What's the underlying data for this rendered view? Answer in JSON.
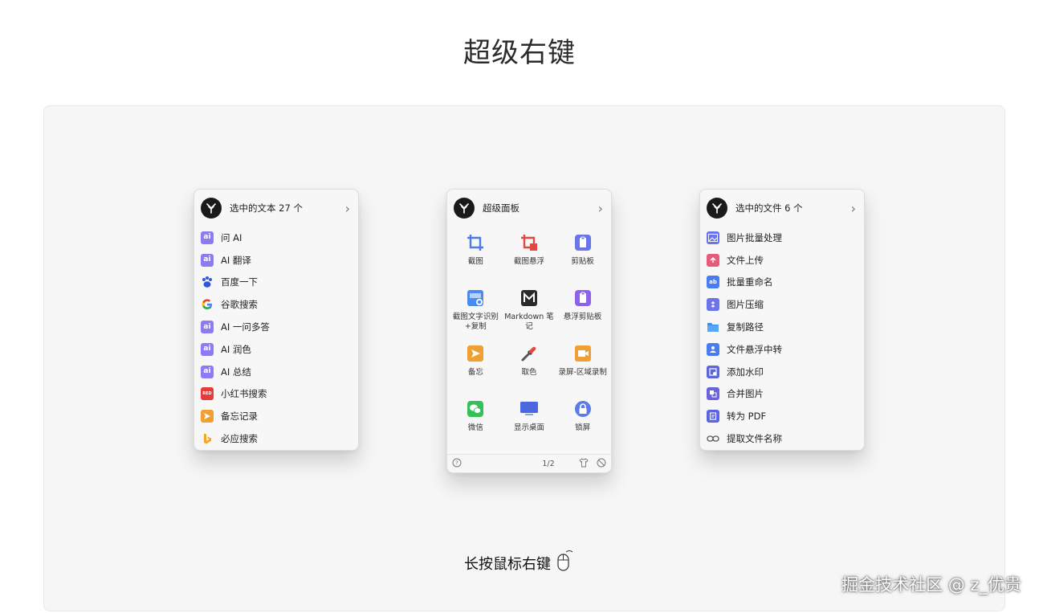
{
  "page": {
    "title": "超级右键"
  },
  "text_panel": {
    "title": "选中的文本 27 个",
    "items": [
      {
        "label": "问 AI",
        "icon": "ai-icon"
      },
      {
        "label": "AI 翻译",
        "icon": "ai-icon"
      },
      {
        "label": "百度一下",
        "icon": "baidu-icon"
      },
      {
        "label": "谷歌搜索",
        "icon": "google-icon"
      },
      {
        "label": "AI 一问多答",
        "icon": "ai-icon"
      },
      {
        "label": "AI 润色",
        "icon": "ai-icon"
      },
      {
        "label": "AI 总结",
        "icon": "ai-icon"
      },
      {
        "label": "小红书搜索",
        "icon": "xiaohongshu-icon"
      },
      {
        "label": "备忘记录",
        "icon": "memo-icon"
      },
      {
        "label": "必应搜索",
        "icon": "bing-icon"
      }
    ]
  },
  "super_panel": {
    "title": "超级面板",
    "items": [
      {
        "label": "截图",
        "icon": "crop-icon"
      },
      {
        "label": "截图悬浮",
        "icon": "crop-float-icon"
      },
      {
        "label": "剪贴板",
        "icon": "clipboard-icon"
      },
      {
        "label": "截图文字识别+复制",
        "icon": "ocr-icon"
      },
      {
        "label": "Markdown 笔记",
        "icon": "markdown-icon"
      },
      {
        "label": "悬浮剪贴板",
        "icon": "float-clipboard-icon"
      },
      {
        "label": "备忘",
        "icon": "memo-icon"
      },
      {
        "label": "取色",
        "icon": "eyedropper-icon"
      },
      {
        "label": "录屏-区域录制",
        "icon": "record-icon"
      },
      {
        "label": "微信",
        "icon": "wechat-icon"
      },
      {
        "label": "显示桌面",
        "icon": "desktop-icon"
      },
      {
        "label": "锁屏",
        "icon": "lock-icon"
      }
    ],
    "page_indicator": "1/2"
  },
  "file_panel": {
    "title": "选中的文件 6 个",
    "items": [
      {
        "label": "图片批量处理",
        "icon": "image-batch-icon"
      },
      {
        "label": "文件上传",
        "icon": "upload-icon"
      },
      {
        "label": "批量重命名",
        "icon": "rename-icon"
      },
      {
        "label": "图片压缩",
        "icon": "compress-icon"
      },
      {
        "label": "复制路径",
        "icon": "folder-icon"
      },
      {
        "label": "文件悬浮中转",
        "icon": "transfer-icon"
      },
      {
        "label": "添加水印",
        "icon": "watermark-icon"
      },
      {
        "label": "合并图片",
        "icon": "merge-icon"
      },
      {
        "label": "转为 PDF",
        "icon": "pdf-icon"
      },
      {
        "label": "提取文件名称",
        "icon": "link-icon"
      }
    ]
  },
  "hint": {
    "text": "长按鼠标右键"
  },
  "watermark": {
    "text": "掘金技术社区 @ z_优贵"
  },
  "colors": {
    "ai": "#8b7cf3",
    "accent_blue": "#5b7be9",
    "accent_orange": "#f0a033",
    "accent_red": "#e2483d",
    "wechat": "#35c15a"
  }
}
